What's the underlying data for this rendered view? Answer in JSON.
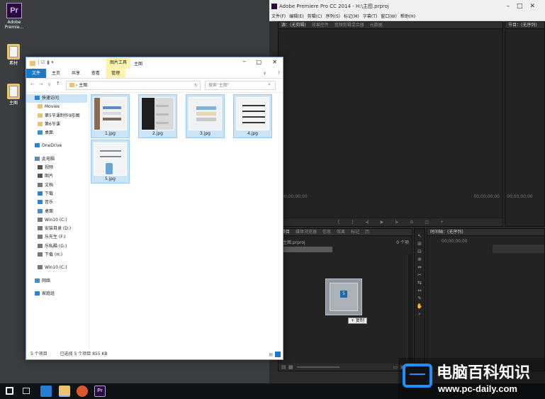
{
  "desktop": {
    "icons": [
      {
        "label": "Adobe Premie...",
        "icon": "premiere-icon"
      },
      {
        "label": "素材",
        "icon": "folder-icon"
      },
      {
        "label": "主图",
        "icon": "folder-icon"
      }
    ]
  },
  "premiere": {
    "window_title": "Adobe Premiere Pro CC 2014 - H:\\主图.prproj",
    "menu": [
      "文件(F)",
      "编辑(E)",
      "剪辑(C)",
      "序列(S)",
      "标记(M)",
      "字幕(T)",
      "窗口(W)",
      "帮助(H)"
    ],
    "source_tabs": [
      "源：(无剪辑)",
      "效果控件",
      "音频剪辑混合器",
      "元数据"
    ],
    "program_tab": "节目：(无序列)",
    "timecode_zero": "00;00;00;00",
    "project_tabs": [
      "项目",
      "媒体浏览器",
      "信息",
      "效果",
      "标记",
      "历"
    ],
    "project_file": "主图.prproj",
    "item_count": "0 个项",
    "timeline_tab": "时间轴：(无序列)",
    "drag_tooltip": "+ 复制",
    "drag_badge": "5"
  },
  "explorer": {
    "title": "主图",
    "picture_tools": "图片工具",
    "ribbon_tabs": [
      "文件",
      "主页",
      "共享",
      "查看",
      "管理"
    ],
    "address": "主图",
    "search_placeholder": "搜索\"主图\"",
    "nav": [
      {
        "label": "快速访问",
        "kind": "star"
      },
      {
        "label": "Movies",
        "kind": "folder"
      },
      {
        "label": "第5节课制作9形图",
        "kind": "folder"
      },
      {
        "label": "第6节课",
        "kind": "folder"
      },
      {
        "label": "桌面",
        "kind": "desktop"
      },
      {
        "label": "",
        "kind": "gap"
      },
      {
        "label": "OneDrive",
        "kind": "cloud"
      },
      {
        "label": "",
        "kind": "gap"
      },
      {
        "label": "此电脑",
        "kind": "pc"
      },
      {
        "label": "视频",
        "kind": "video"
      },
      {
        "label": "图片",
        "kind": "picture"
      },
      {
        "label": "文档",
        "kind": "doc"
      },
      {
        "label": "下载",
        "kind": "download"
      },
      {
        "label": "音乐",
        "kind": "music"
      },
      {
        "label": "桌面",
        "kind": "desktop"
      },
      {
        "label": "Win10 (C:)",
        "kind": "drive"
      },
      {
        "label": "安装目录 (D:)",
        "kind": "drive"
      },
      {
        "label": "乐先生 (F:)",
        "kind": "drive"
      },
      {
        "label": "乐私酷 (G:)",
        "kind": "drive"
      },
      {
        "label": "下载 (H:)",
        "kind": "drive"
      },
      {
        "label": "",
        "kind": "gap"
      },
      {
        "label": "Win10 (C:)",
        "kind": "drive"
      },
      {
        "label": "",
        "kind": "gap"
      },
      {
        "label": "网络",
        "kind": "network"
      },
      {
        "label": "",
        "kind": "gap"
      },
      {
        "label": "家庭组",
        "kind": "homegroup"
      }
    ],
    "files": [
      "1.jpg",
      "2.jpg",
      "3.jpg",
      "4.jpg",
      "5.jpg"
    ],
    "status_count": "5 个项目",
    "status_selected": "已选择 5 个项目 855 KB"
  },
  "watermark": {
    "title": "电脑百科知识",
    "url": "www.pc-daily.com"
  },
  "colors": {
    "selection": "#cce4f7",
    "premiere_bg": "#232323",
    "accent": "#0078d7"
  }
}
